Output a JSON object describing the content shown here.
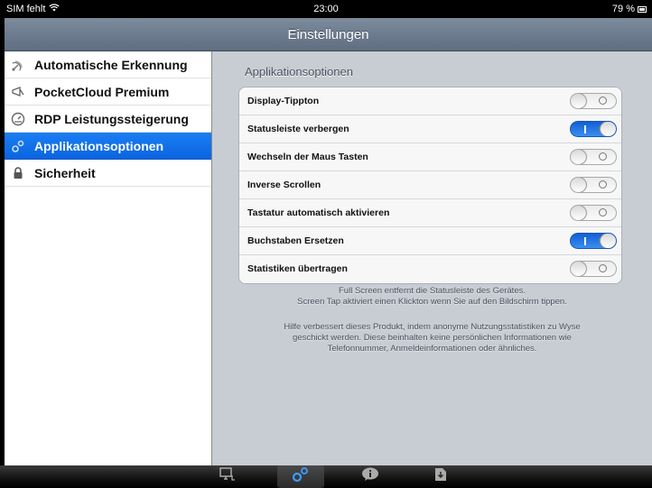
{
  "status_bar": {
    "carrier": "SIM fehlt",
    "time": "23:00",
    "battery": "79 %"
  },
  "nav": {
    "title": "Einstellungen"
  },
  "sidebar": {
    "items": [
      {
        "label": "Automatische Erkennung",
        "icon": "radar-icon",
        "selected": false
      },
      {
        "label": "PocketCloud Premium",
        "icon": "megaphone-icon",
        "selected": false
      },
      {
        "label": "RDP Leistungssteigerung",
        "icon": "speedometer-icon",
        "selected": false
      },
      {
        "label": "Applikationsoptionen",
        "icon": "gears-icon",
        "selected": true
      },
      {
        "label": "Sicherheit",
        "icon": "lock-icon",
        "selected": false
      }
    ]
  },
  "main": {
    "section_title": "Applikationsoptionen",
    "rows": [
      {
        "label": "Display-Tippton",
        "on": false
      },
      {
        "label": "Statusleiste verbergen",
        "on": true
      },
      {
        "label": "Wechseln der Maus Tasten",
        "on": false
      },
      {
        "label": "Inverse Scrollen",
        "on": false
      },
      {
        "label": "Tastatur automatisch aktivieren",
        "on": false
      },
      {
        "label": "Buchstaben Ersetzen",
        "on": true
      },
      {
        "label": "Statistiken übertragen",
        "on": false
      }
    ],
    "footnote1": [
      "Full Screen entfernt die Statusleiste des Gerätes.",
      "Screen Tap aktiviert einen Klickton wenn Sie auf den Bildschirm tippen."
    ],
    "footnote2": [
      "Hilfe verbessert dieses Produkt, indem anonyme Nutzungsstatistiken zu Wyse",
      "geschickt werden. Diese beinhalten keine persönlichen Informationen wie",
      "Telefonnummer, Anmeldeinformationen oder ähnliches."
    ]
  },
  "tab_bar": {
    "tabs": [
      {
        "icon": "desktop-icon",
        "active": false
      },
      {
        "icon": "gears-icon",
        "active": true
      },
      {
        "icon": "info-icon",
        "active": false
      },
      {
        "icon": "download-icon",
        "active": false
      }
    ]
  },
  "colors": {
    "accent": "#0a6cf0",
    "nav_bar": "#6d7c8e",
    "panel_background": "#c8cdd4"
  }
}
